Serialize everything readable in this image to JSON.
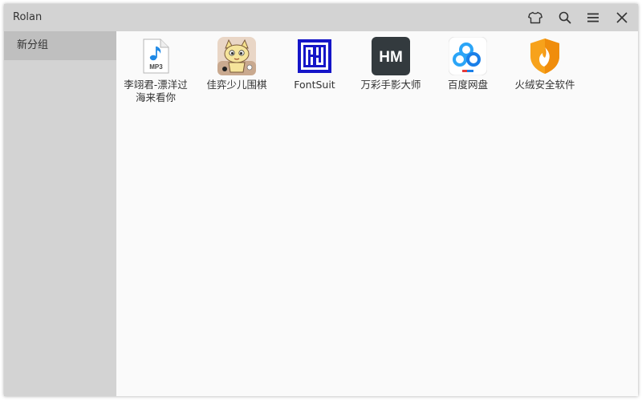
{
  "window": {
    "title": "Rolan"
  },
  "titlebar_buttons": [
    {
      "name": "skin-button",
      "icon": "shirt-icon"
    },
    {
      "name": "search-button",
      "icon": "search-icon"
    },
    {
      "name": "menu-button",
      "icon": "hamburger-icon"
    },
    {
      "name": "close-button",
      "icon": "close-icon"
    }
  ],
  "sidebar": {
    "groups": [
      {
        "label": "新分组",
        "selected": true
      }
    ]
  },
  "main": {
    "items": [
      {
        "label": "李翊君-漂洋过海来看你",
        "icon": "mp3-file-icon"
      },
      {
        "label": "佳弈少儿围棋",
        "icon": "cartoon-cat-icon"
      },
      {
        "label": "FontSuit",
        "icon": "fontsuit-logo-icon"
      },
      {
        "label": "万彩手影大师",
        "icon": "hm-logo-icon"
      },
      {
        "label": "百度网盘",
        "icon": "baidu-netdisk-icon"
      },
      {
        "label": "火绒安全软件",
        "icon": "huorong-shield-icon"
      }
    ]
  },
  "colors": {
    "titlebar": "#d3d3d3",
    "sidebar_selected": "#bfbfbf",
    "content_bg": "#fafafa",
    "text": "#333333"
  }
}
